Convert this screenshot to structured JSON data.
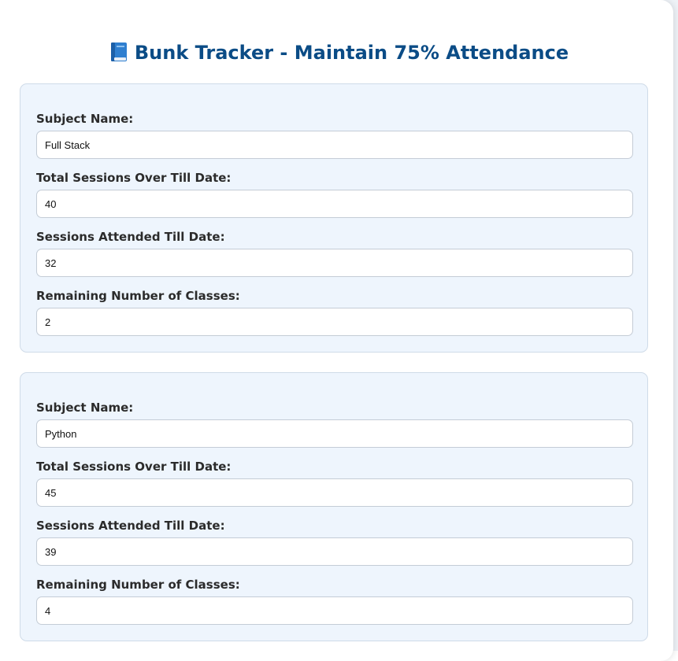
{
  "app": {
    "title": "Bunk Tracker - Maintain 75% Attendance",
    "title_icon": "blue-book-icon",
    "accent_color": "#0b4c86",
    "card_background": "#eef5fd"
  },
  "labels": {
    "subject": "Subject Name:",
    "total": "Total Sessions Over Till Date:",
    "attended": "Sessions Attended Till Date:",
    "remaining": "Remaining Number of Classes:"
  },
  "subjects": [
    {
      "subject_name": "Full Stack",
      "total_sessions": "40",
      "attended_sessions": "32",
      "remaining_classes": "2"
    },
    {
      "subject_name": "Python",
      "total_sessions": "45",
      "attended_sessions": "39",
      "remaining_classes": "4"
    }
  ]
}
